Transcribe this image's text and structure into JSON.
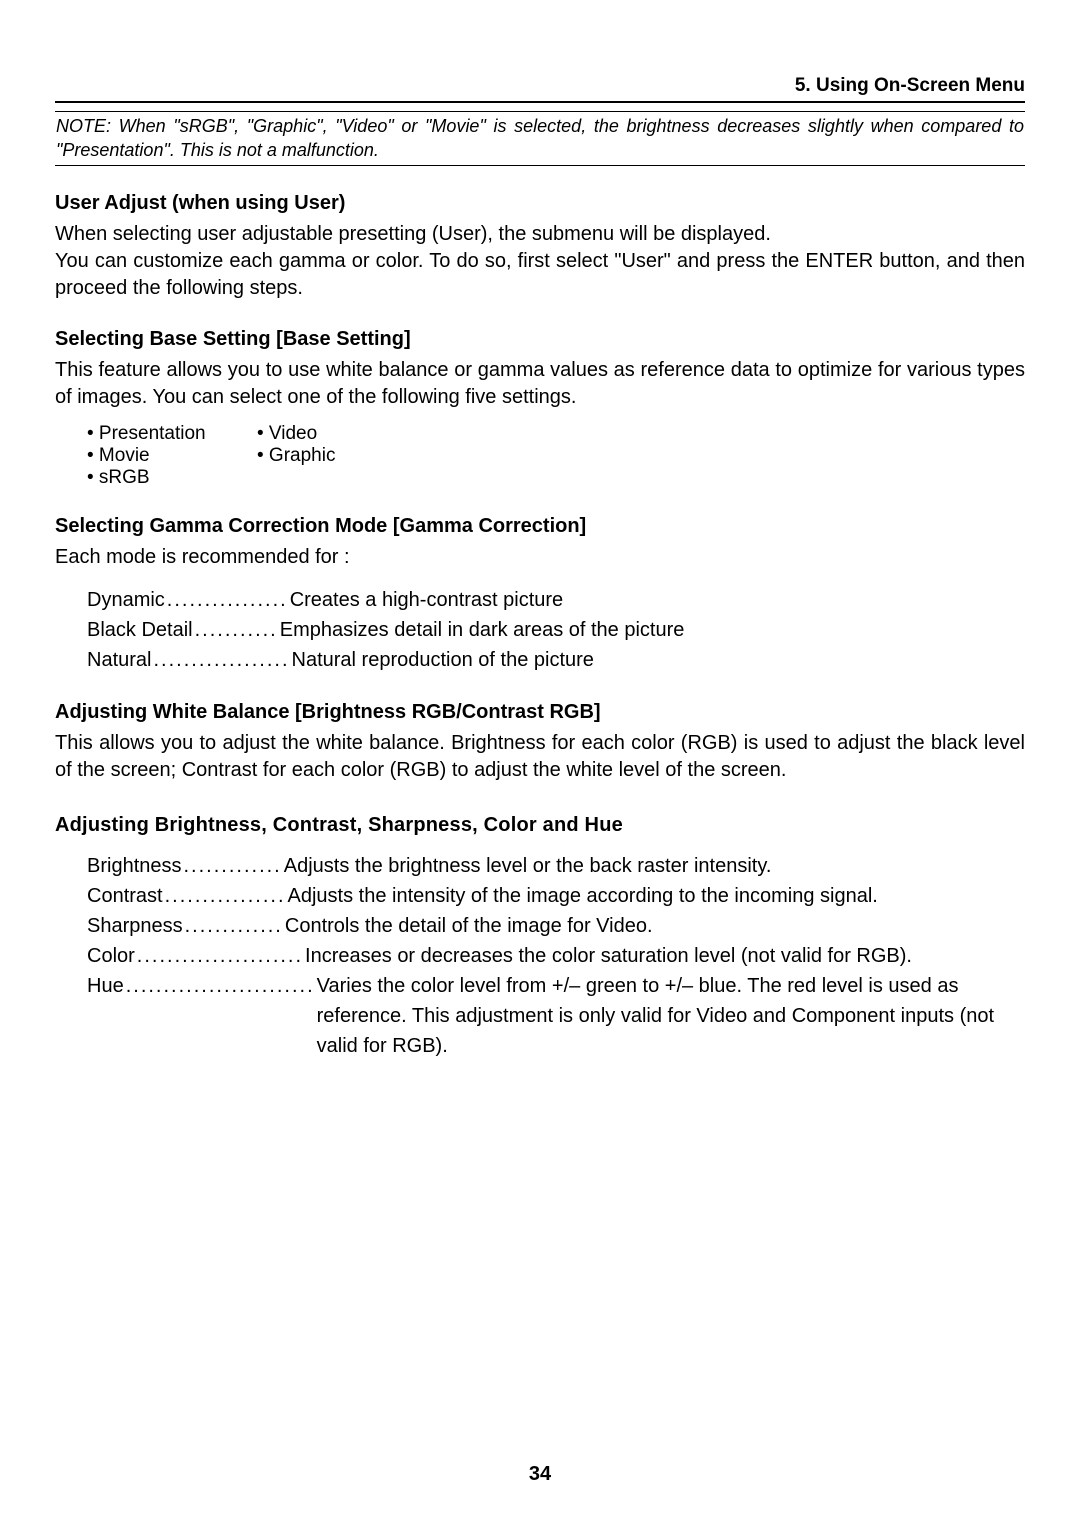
{
  "header": {
    "chapter": "5. Using On-Screen Menu"
  },
  "note": "NOTE: When \"sRGB\", \"Graphic\", \"Video\" or \"Movie\" is selected, the brightness decreases slightly when compared to \"Presentation\". This is not a malfunction.",
  "sections": {
    "user_adjust": {
      "heading": "User Adjust (when using User)",
      "p1": "When selecting user adjustable presetting (User), the submenu will be displayed.",
      "p2": "You can customize each gamma or color. To do so, first select \"User\" and press the ENTER button, and then proceed the following steps."
    },
    "base_setting": {
      "heading": "Selecting Base Setting [Base Setting]",
      "p": "This feature allows you to use white balance or gamma values as reference data to optimize for various types of images. You can select one of the following five settings.",
      "bullets": {
        "r1c1": "• Presentation",
        "r1c2": "• Video",
        "r2c1": "• Movie",
        "r2c2": "• Graphic",
        "r3c1": "• sRGB"
      }
    },
    "gamma": {
      "heading": "Selecting Gamma Correction Mode [Gamma Correction]",
      "p": "Each mode is recommended for :",
      "rows": [
        {
          "label": "Dynamic",
          "desc": "Creates a high-contrast picture"
        },
        {
          "label": "Black Detail",
          "desc": "Emphasizes detail in dark areas of the picture"
        },
        {
          "label": "Natural",
          "desc": "Natural reproduction of the picture"
        }
      ]
    },
    "white_balance": {
      "heading": "Adjusting White Balance [Brightness RGB/Contrast RGB]",
      "p": "This allows you to adjust the white balance. Brightness for each color (RGB) is used to adjust the black level of the screen; Contrast for each color (RGB) to adjust the white level of the screen."
    },
    "adjusting_all": {
      "heading": "Adjusting Brightness, Contrast, Sharpness, Color and Hue",
      "rows": [
        {
          "label": "Brightness",
          "desc": "Adjusts the brightness level or the back raster intensity."
        },
        {
          "label": "Contrast",
          "desc": "Adjusts the intensity of the image according to the incoming signal."
        },
        {
          "label": "Sharpness",
          "desc": "Controls the detail of the image for Video."
        },
        {
          "label": "Color",
          "desc": "Increases or decreases the color saturation level (not valid for RGB)."
        },
        {
          "label": "Hue",
          "desc": "Varies the color level from +/– green to +/– blue. The red level is used as reference. This adjustment is only valid for Video and Component inputs (not valid for RGB)."
        }
      ]
    }
  },
  "page_number": "34"
}
